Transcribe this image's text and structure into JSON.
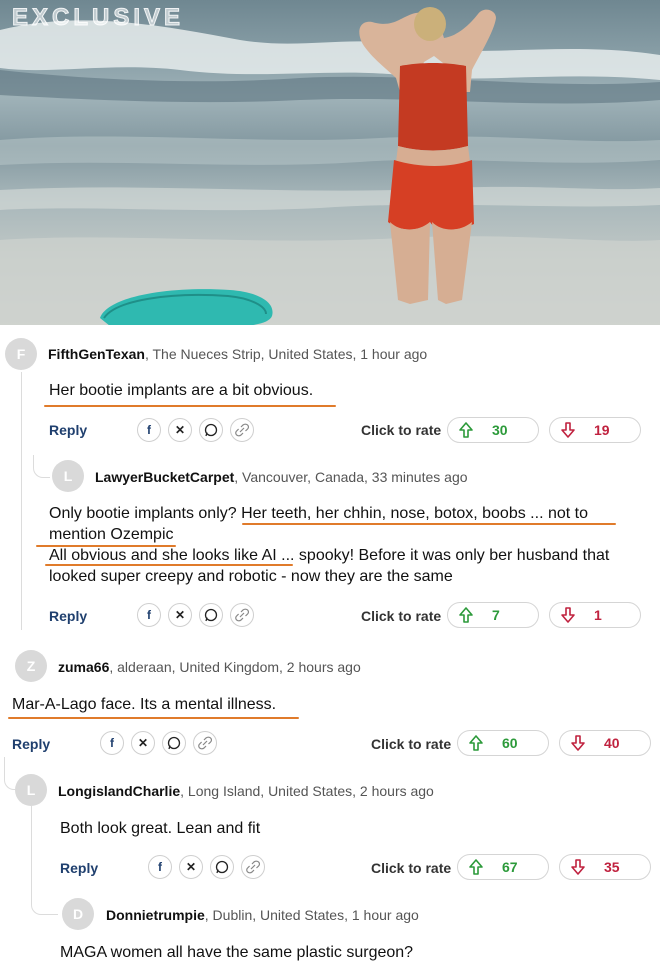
{
  "hero": {
    "watermark": "EXCLUSIVE"
  },
  "ui": {
    "reply": "Reply",
    "click_to_rate": "Click to rate"
  },
  "colors": {
    "upvote": "#2c9a3a",
    "downvote": "#c0223f",
    "underline": "#e07b2b",
    "reply": "#1f3f6e"
  },
  "share_icons": [
    "facebook-icon",
    "x-icon",
    "whatsapp-icon",
    "link-icon"
  ],
  "comments": [
    {
      "initial": "F",
      "user": "FifthGenTexan",
      "location": ", The Nueces Strip, United States, 1 hour ago",
      "text": "Her bootie implants are a bit obvious.",
      "up": "30",
      "down": "19"
    },
    {
      "initial": "L",
      "user": "LawyerBucketCarpet",
      "location": ", Vancouver, Canada, 33 minutes ago",
      "line1": "Only bootie implants only? Her teeth, her chhin, nose, botox, boobs ... not to",
      "line2": "mention Ozempic",
      "line3": "All obvious and she looks like AI ... spooky! Before it was only ber husband that",
      "line4": "looked super creepy and robotic - now they are the same",
      "up": "7",
      "down": "1"
    },
    {
      "initial": "Z",
      "user": "zuma66",
      "location": ", alderaan, United Kingdom, 2 hours ago",
      "text": "Mar-A-Lago face. Its a mental illness.",
      "up": "60",
      "down": "40"
    },
    {
      "initial": "L",
      "user": "LongislandCharlie",
      "location": ", Long Island, United States, 2 hours ago",
      "text": "Both look great. Lean and fit",
      "up": "67",
      "down": "35"
    },
    {
      "initial": "D",
      "user": "Donnietrumpie",
      "location": ", Dublin, United States, 1 hour ago",
      "text": "MAGA women all have the same plastic surgeon?"
    }
  ]
}
